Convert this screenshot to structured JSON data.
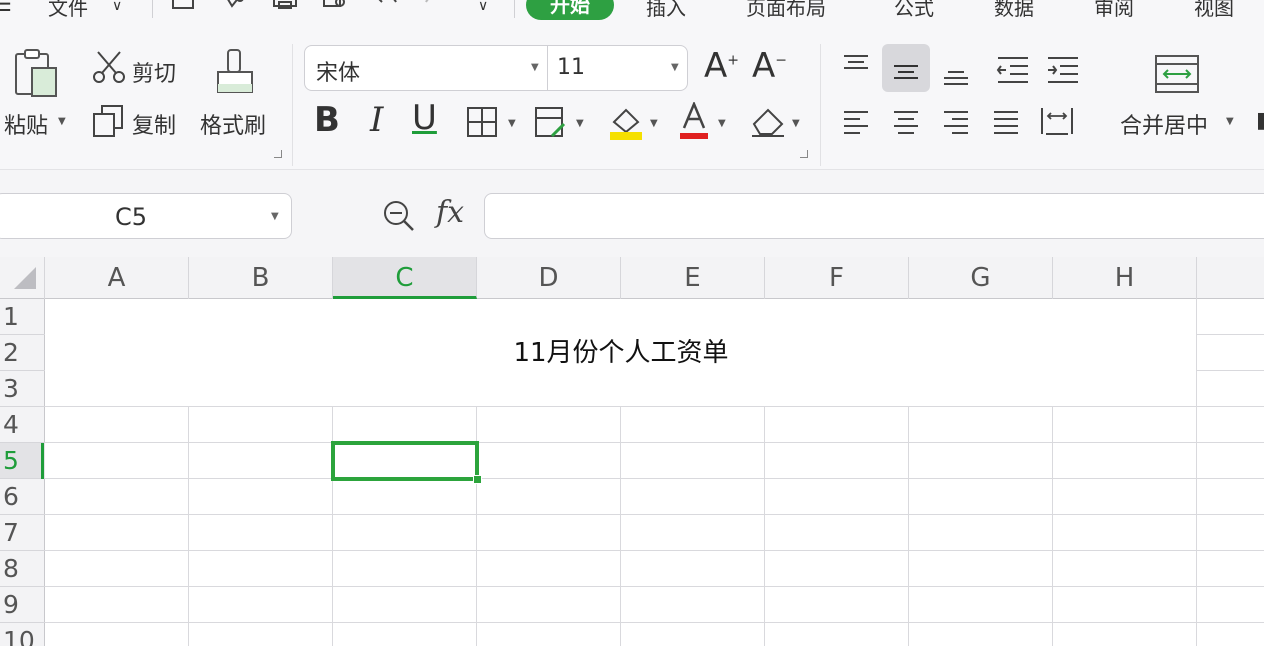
{
  "menubar": {
    "file": "文件",
    "tabs": [
      "开始",
      "插入",
      "页面布局",
      "公式",
      "数据",
      "审阅",
      "视图"
    ]
  },
  "ribbon": {
    "clipboard": {
      "paste": "粘贴",
      "cut": "剪切",
      "copy": "复制",
      "format_painter": "格式刷"
    },
    "font": {
      "name": "宋体",
      "size": "11"
    },
    "alignment": {
      "merge_center": "合并居中"
    }
  },
  "formula_bar": {
    "cell_ref": "C5",
    "fx": "fx",
    "value": ""
  },
  "sheet": {
    "columns": [
      "A",
      "B",
      "C",
      "D",
      "E",
      "F",
      "G",
      "H"
    ],
    "rows": [
      "1",
      "2",
      "3",
      "4",
      "5",
      "6",
      "7",
      "8",
      "9",
      "10"
    ],
    "merged_title": "11月份个人工资单",
    "active_cell": "C5"
  },
  "colors": {
    "accent": "#2ea042",
    "selection": "#2ca43c",
    "font_color_bar": "#e02020",
    "highlight_bar": "#f5e000"
  }
}
